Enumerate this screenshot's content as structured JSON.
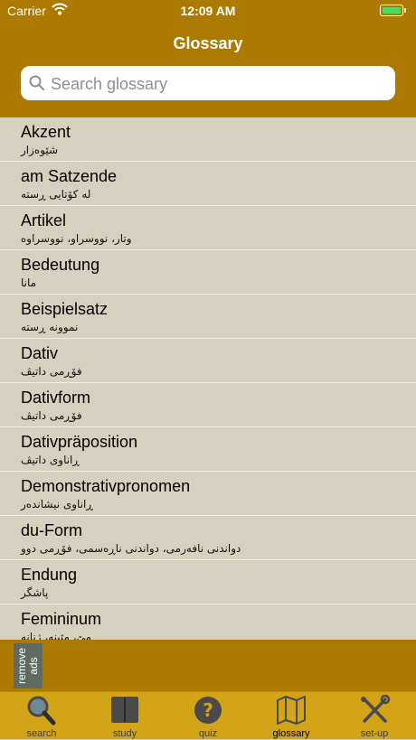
{
  "status": {
    "carrier": "Carrier",
    "time": "12:09 AM"
  },
  "nav": {
    "title": "Glossary"
  },
  "search": {
    "placeholder": "Search glossary"
  },
  "entries": [
    {
      "term": "Akzent",
      "translation": "شێوەزار"
    },
    {
      "term": "am Satzende",
      "translation": "لە کۆتایی ڕستە"
    },
    {
      "term": "Artikel",
      "translation": "وتار، نووسراو، نووسراوە"
    },
    {
      "term": "Bedeutung",
      "translation": "مانا"
    },
    {
      "term": "Beispielsatz",
      "translation": "نموونە ڕستە"
    },
    {
      "term": "Dativ",
      "translation": "فۆڕمی داتیڤ"
    },
    {
      "term": "Dativform",
      "translation": "فۆڕمی داتیڤ"
    },
    {
      "term": "Dativpräposition",
      "translation": "ڕاناوی داتیڤ"
    },
    {
      "term": "Demonstrativpronomen",
      "translation": "ڕاناوی نیشاندەر"
    },
    {
      "term": "du-Form",
      "translation": "دواندنی نافەرمی، دواندنی ناڕەسمی، فۆڕمی دوو"
    },
    {
      "term": "Endung",
      "translation": "پاشگر"
    },
    {
      "term": "Femininum",
      "translation": "مێ، مێینە، ژنانە"
    }
  ],
  "ads": {
    "remove_label_1": "remove",
    "remove_label_2": "ads"
  },
  "tabs": [
    {
      "label": "search",
      "icon": "magnifier-icon"
    },
    {
      "label": "study",
      "icon": "book-icon"
    },
    {
      "label": "quiz",
      "icon": "question-icon"
    },
    {
      "label": "glossary",
      "icon": "map-icon",
      "active": true
    },
    {
      "label": "set-up",
      "icon": "tools-icon"
    }
  ],
  "colors": {
    "bar": "#ad7a00",
    "tabbar": "#d3a318",
    "list_bg": "#d6d0bf"
  }
}
